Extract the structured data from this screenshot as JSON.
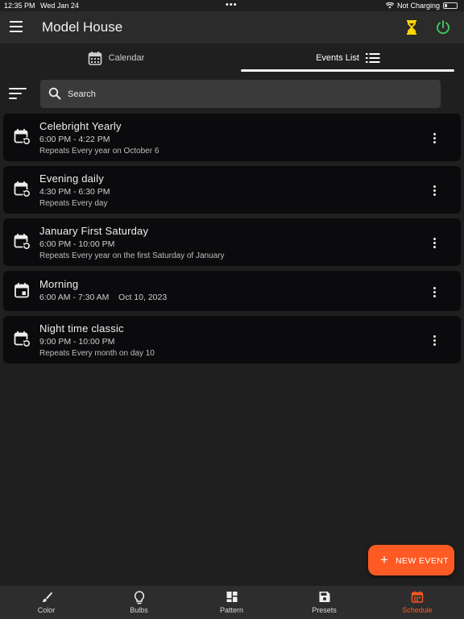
{
  "status_bar": {
    "time": "12:35 PM",
    "date": "Wed Jan 24",
    "dots": "•••",
    "charging": "Not Charging"
  },
  "app_bar": {
    "title": "Model House"
  },
  "tabs": [
    {
      "label": "Calendar",
      "active": false
    },
    {
      "label": "Events List",
      "active": true
    }
  ],
  "search": {
    "placeholder": "Search"
  },
  "events": [
    {
      "title": "Celebright Yearly",
      "time": "6:00 PM - 4:22 PM",
      "repeat": "Repeats Every year on October 6",
      "icon": "calendar-repeat-icon"
    },
    {
      "title": "Evening daily",
      "time": "4:30 PM - 6:30 PM",
      "repeat": "Repeats Every day",
      "icon": "calendar-repeat-icon"
    },
    {
      "title": "January First Saturday",
      "time": "6:00 PM - 10:00 PM",
      "repeat": "Repeats Every year on the first Saturday of January",
      "icon": "calendar-repeat-icon"
    },
    {
      "title": "Morning",
      "time": "6:00 AM - 7:30 AM    Oct 10, 2023",
      "repeat": "",
      "icon": "calendar-event-icon"
    },
    {
      "title": "Night time classic",
      "time": "9:00 PM - 10:00 PM",
      "repeat": "Repeats Every month on day 10",
      "icon": "calendar-repeat-icon"
    }
  ],
  "fab": {
    "label": "NEW EVENT"
  },
  "bottom_nav": [
    {
      "label": "Color",
      "icon": "brush-icon",
      "active": false
    },
    {
      "label": "Bulbs",
      "icon": "lightbulb-icon",
      "active": false
    },
    {
      "label": "Pattern",
      "icon": "pattern-grid-icon",
      "active": false
    },
    {
      "label": "Presets",
      "icon": "save-icon",
      "active": false
    },
    {
      "label": "Schedule",
      "icon": "calendar-icon",
      "active": true
    }
  ],
  "colors": {
    "accent": "#ff5a23",
    "hourglass": "#ffd600",
    "power": "#3ec35a",
    "card_bg": "#0b0b0d",
    "page_bg": "#1f1f1f"
  }
}
